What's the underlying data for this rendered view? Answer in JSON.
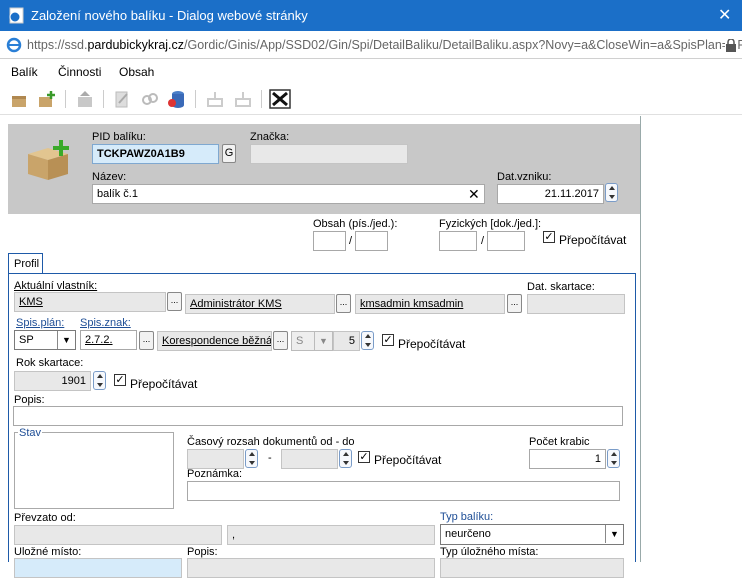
{
  "window": {
    "title": "Založení nového balíku - Dialog webové stránky",
    "close": "✕"
  },
  "address": {
    "prefix": "https://ssd.",
    "domain": "pardubickykraj.cz",
    "path": "/Gordic/Ginis/App/SSD02/Gin/Spi/DetailBaliku/DetailBaliku.aspx?Novy=a&CloseWin=a&SpisPlan=SP&"
  },
  "menu": [
    "Balík",
    "Činnosti",
    "Obsah"
  ],
  "header": {
    "pid_label": "PID balíku:",
    "pid_value": "TCKPAWZ0A1B9",
    "g_btn": "G",
    "znacka_label": "Značka:",
    "znacka_value": "",
    "nazev_label": "Název:",
    "nazev_value": "balík č.1",
    "clear": "✕",
    "datvzniku_label": "Dat.vzniku:",
    "datvzniku_value": "21.11.2017"
  },
  "obsah": {
    "label": "Obsah (pís./jed.):",
    "v1": "",
    "slash": "/",
    "v2": "",
    "fyz_label": "Fyzických [dok./jed.]:",
    "f1": "",
    "f2": "",
    "recalc": "Přepočítávat"
  },
  "tabs": [
    "Profil"
  ],
  "profil": {
    "vlastnik_label": "Aktuální vlastník:",
    "vlastnik": "KMS",
    "admin": "Administrátor KMS",
    "kmsadmin": "kmsadmin kmsadmin",
    "dots": "...",
    "skartace_label": "Dat. skartace:",
    "skartace": "",
    "spisplan_label": "Spis.plán:",
    "spisplan": "SP",
    "spiszn_label": "Spis.znak:",
    "spiszn": "2.7.2.",
    "korespondence": "Korespondence běžná",
    "s_val": "S",
    "num5": "5",
    "recalc": "Přepočítávat",
    "rok_label": "Rok skartace:",
    "rok": "1901",
    "popis_label": "Popis:",
    "popis": "",
    "stav_label": "Stav",
    "casovy_label": "Časový rozsah dokumentů od - do",
    "dash": "-",
    "pocet_label": "Počet krabic",
    "pocet": "1",
    "poznamka_label": "Poznámka:",
    "prevzato_label": "Převzato od:",
    "comma": ",",
    "typ_label": "Typ balíku:",
    "typ": "neurčeno",
    "ulozne_label": "Uložné místo:",
    "popis2_label": "Popis:",
    "typulozne_label": "Typ úložného místa:"
  },
  "colors": {
    "titlebar": "#1b6fc8",
    "panel_border": "#1e5aa8",
    "header_bg": "#c8c8c8"
  }
}
